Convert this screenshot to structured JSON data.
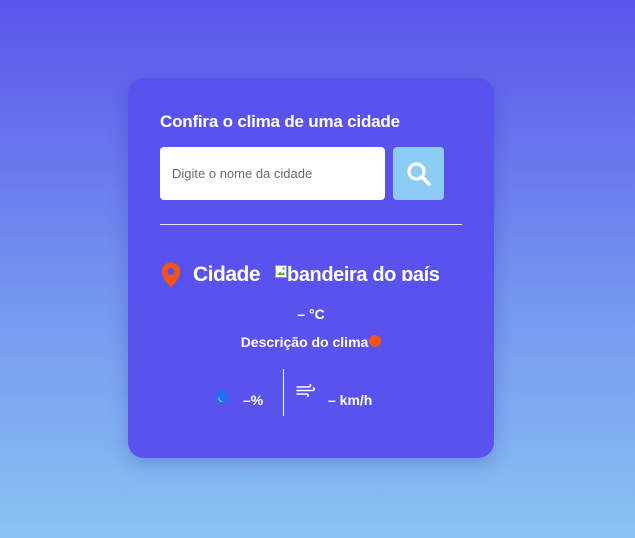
{
  "app": {
    "title": "Confira o clima de uma cidade"
  },
  "search": {
    "placeholder": "Digite o nome da cidade",
    "value": "",
    "button_icon": "search-icon"
  },
  "location": {
    "icon": "map-pin-icon",
    "city": "Cidade",
    "flag_alt": "bandeira do país"
  },
  "weather": {
    "temperature": "–  °C",
    "description": "Descrição do clima",
    "description_icon": "weather-icon"
  },
  "details": {
    "humidity_icon": "water-drop-icon",
    "humidity": "–%",
    "wind_icon": "wind-icon",
    "wind": "– km/h"
  },
  "colors": {
    "background_top": "#5b56ec",
    "background_bottom": "#88c4f3",
    "card": "#5a52ec",
    "search_button": "#8dccf4",
    "pin": "#f2541b",
    "drop": "#1a73f0"
  }
}
